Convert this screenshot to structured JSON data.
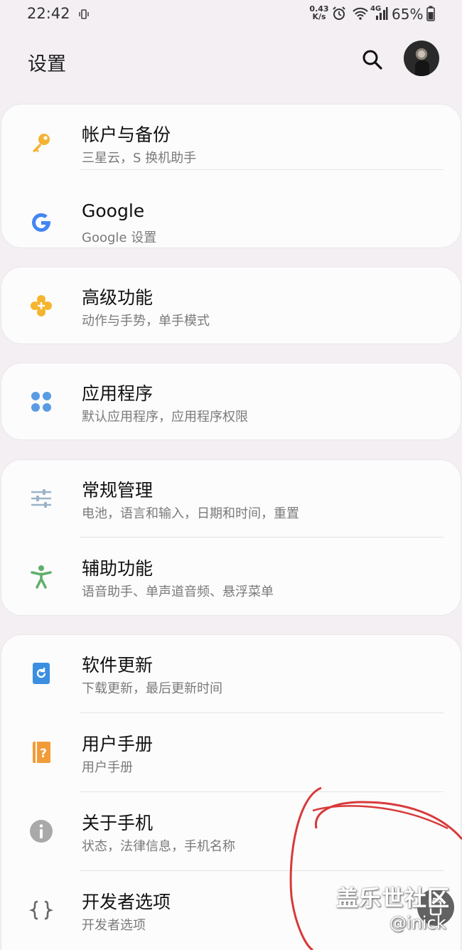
{
  "status_bar": {
    "time": "22:42",
    "net_speed_value": "0.43",
    "net_speed_unit": "K/s",
    "network_type": "4G",
    "battery": "65%"
  },
  "header": {
    "title": "设置"
  },
  "sections": [
    {
      "items": [
        {
          "title": "帐户与备份",
          "subtitle": "三星云，S 换机助手",
          "icon": "key-icon",
          "color": "#f4b334"
        },
        {
          "title": "Google",
          "subtitle": "Google 设置",
          "icon": "google-icon",
          "color": "#4285f4"
        }
      ]
    },
    {
      "items": [
        {
          "title": "高级功能",
          "subtitle": "动作与手势，单手模式",
          "icon": "advanced-features-icon",
          "color": "#f5b52e"
        }
      ]
    },
    {
      "items": [
        {
          "title": "应用程序",
          "subtitle": "默认应用程序，应用程序权限",
          "icon": "apps-icon",
          "color": "#5b9be3"
        }
      ]
    },
    {
      "items": [
        {
          "title": "常规管理",
          "subtitle": "电池，语言和输入，日期和时间，重置",
          "icon": "sliders-icon",
          "color": "#9bb3c8"
        },
        {
          "title": "辅助功能",
          "subtitle": "语音助手、单声道音频、悬浮菜单",
          "icon": "accessibility-icon",
          "color": "#5fae6a"
        }
      ]
    },
    {
      "items": [
        {
          "title": "软件更新",
          "subtitle": "下载更新，最后更新时间",
          "icon": "software-update-icon",
          "color": "#3b8fe0"
        },
        {
          "title": "用户手册",
          "subtitle": "用户手册",
          "icon": "user-manual-icon",
          "color": "#f29c38"
        },
        {
          "title": "关于手机",
          "subtitle": "状态，法律信息，手机名称",
          "icon": "info-icon",
          "color": "#a9a9a9"
        },
        {
          "title": "开发者选项",
          "subtitle": "开发者选项",
          "icon": "developer-braces-icon",
          "color": "#666666"
        }
      ]
    }
  ],
  "watermark": {
    "site": "盖乐世社区",
    "user": "@inick"
  }
}
